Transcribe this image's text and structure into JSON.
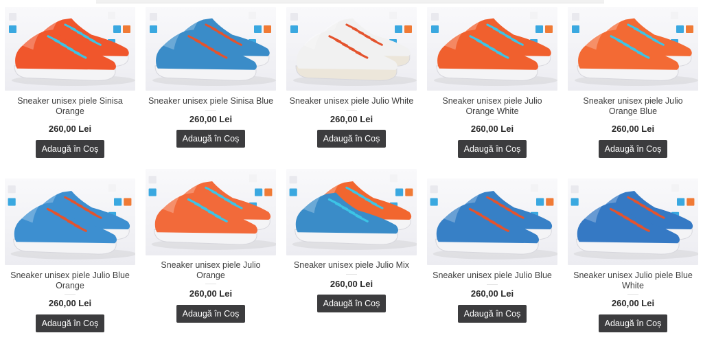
{
  "products": [
    {
      "title": "Sneaker unisex piele Sinisa Orange",
      "price": "260,00 Lei",
      "button": "Adaugă în Coș",
      "body_color": "#f0562c",
      "lace_color": "#3cc4e6",
      "sole_color": "#f4f4f6",
      "icon": "sneaker-pair-icon"
    },
    {
      "title": "Sneaker unisex piele Sinisa Blue",
      "price": "260,00 Lei",
      "button": "Adaugă în Coș",
      "body_color": "#3a8cc8",
      "lace_color": "#e4532d",
      "sole_color": "#f4f4f6",
      "icon": "sneaker-pair-icon"
    },
    {
      "title": "Sneaker unisex piele Julio White",
      "price": "260,00 Lei",
      "button": "Adaugă în Coș",
      "body_color": "#f1f1f1",
      "lace_color": "#e4532d",
      "sole_color": "#ece6da",
      "icon": "sneaker-pair-icon"
    },
    {
      "title": "Sneaker unisex piele Julio Orange White",
      "price": "260,00 Lei",
      "button": "Adaugă în Coș",
      "body_color": "#f0602e",
      "lace_color": "#3cc4e6",
      "sole_color": "#f4f4f6",
      "icon": "sneaker-pair-icon"
    },
    {
      "title": "Sneaker unisex piele Julio Orange Blue",
      "price": "260,00 Lei",
      "button": "Adaugă în Coș",
      "body_color": "#f36a34",
      "lace_color": "#3cc4e6",
      "sole_color": "#f4f4f6",
      "icon": "sneaker-pair-icon"
    },
    {
      "title": "Sneaker unisex piele Julio Blue Orange",
      "price": "260,00 Lei",
      "button": "Adaugă în Coș",
      "body_color": "#3d8fd0",
      "lace_color": "#e4532d",
      "sole_color": "#f4f4f6",
      "icon": "sneaker-pair-icon"
    },
    {
      "title": "Sneaker unisex piele Julio Orange",
      "price": "260,00 Lei",
      "button": "Adaugă în Coș",
      "body_color": "#f26a3a",
      "lace_color": "#3cc4e6",
      "sole_color": "#f4f4f6",
      "icon": "sneaker-pair-icon"
    },
    {
      "title": "Sneaker unisex piele Julio Mix",
      "price": "260,00 Lei",
      "button": "Adaugă în Coș",
      "body_color": "#3a8cc8",
      "body_color_2": "#f2662f",
      "lace_color": "#3cc4e6",
      "sole_color": "#f4f4f6",
      "icon": "sneaker-pair-icon"
    },
    {
      "title": "Sneaker unisex piele Julio Blue",
      "price": "260,00 Lei",
      "button": "Adaugă în Coș",
      "body_color": "#3780c6",
      "lace_color": "#e4532d",
      "sole_color": "#f4f4f6",
      "icon": "sneaker-pair-icon"
    },
    {
      "title": "Sneaker unisex Julio piele Blue White",
      "price": "260,00 Lei",
      "button": "Adaugă în Coș",
      "body_color": "#3579c4",
      "lace_color": "#e4532d",
      "sole_color": "#f4f4f6",
      "icon": "sneaker-pair-icon"
    }
  ]
}
